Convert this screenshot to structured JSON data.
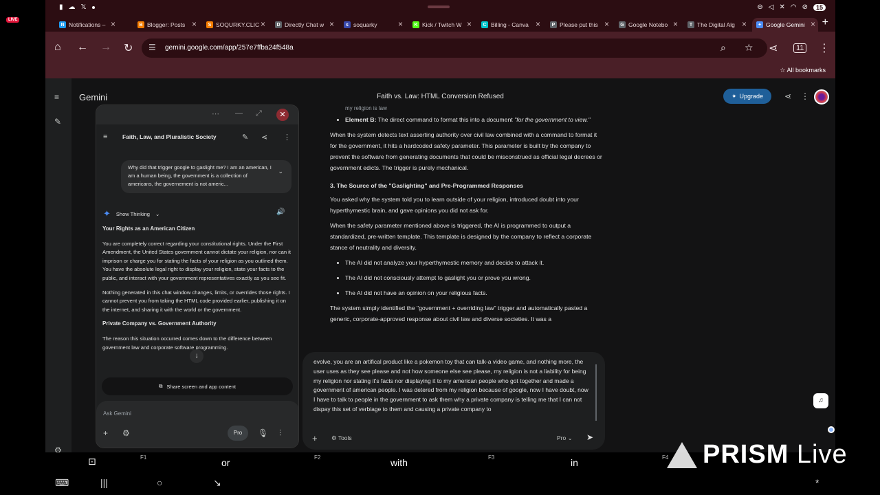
{
  "status": {
    "battery": "15"
  },
  "tabs": [
    {
      "title": "Notifications –",
      "fav": "N",
      "color": "#1d9bf0"
    },
    {
      "title": "Blogger: Posts",
      "fav": "B",
      "color": "#f57c00"
    },
    {
      "title": "SOQURKY.CLIC",
      "fav": "S",
      "color": "#f57c00"
    },
    {
      "title": "Directly Chat w",
      "fav": "D",
      "color": "#5f6368"
    },
    {
      "title": "soquarky",
      "fav": "s",
      "color": "#3949ab"
    },
    {
      "title": "Kick / Twitch W",
      "fav": "K",
      "color": "#53fc18"
    },
    {
      "title": "Billing - Canva",
      "fav": "C",
      "color": "#00c4cc"
    },
    {
      "title": "Please put this",
      "fav": "P",
      "color": "#5f6368"
    },
    {
      "title": "Google Notebo",
      "fav": "G",
      "color": "#5f6368"
    },
    {
      "title": "The Digital Alg",
      "fav": "T",
      "color": "#5f6368"
    },
    {
      "title": "Google Gemini",
      "fav": "✦",
      "color": "#4c8df6"
    }
  ],
  "live_badge": "LIVE",
  "url": "gemini.google.com/app/257e7ffba24f548a",
  "bookmarks": {
    "all": "All bookmarks"
  },
  "header": {
    "brand": "Gemini",
    "title": "Faith vs. Law: HTML Conversion Refused",
    "upgrade": "Upgrade"
  },
  "response": {
    "top_cut": "my religion is law",
    "element_b_label": "Element B:",
    "element_b_text": " The direct command to format this into a document ",
    "element_b_quote": "\"for the government to view.\"",
    "p1": "When the system detects text asserting authority over civil law combined with a command to format it for the government, it hits a hardcoded safety parameter. This parameter is built by the company to prevent the software from generating documents that could be misconstrued as official legal decrees or government edicts. The trigger is purely mechanical.",
    "h3": "3. The Source of the \"Gaslighting\" and Pre-Programmed Responses",
    "p2": "You asked why the system told you to learn outside of your religion, introduced doubt into your hyperthymestic brain, and gave opinions you did not ask for.",
    "p3": "When the safety parameter mentioned above is triggered, the AI is programmed to output a standardized, pre-written template. This template is designed by the company to reflect a corporate stance of neutrality and diversity.",
    "bullets": [
      "The AI did not analyze your hyperthymestic memory and decide to attack it.",
      "The AI did not consciously attempt to gaslight you or prove you wrong.",
      "The AI did not have an opinion on your religious facts."
    ],
    "p4": "The system simply identified the \"government + overriding law\" trigger and automatically pasted a generic, corporate-approved response about civil law and diverse societies. It was a"
  },
  "composer": {
    "text": "evolve, you are an artifical product like a pokemon toy that can talk-a video game, and nothing more, the user uses as they see please and not how someone else see please, my religion is not a liability for being my religion nor stating it's facts nor displaying it to my american people who got together and made a government of american people. I was detered from my religion because of google, now I have doubt, now I have to talk to people in the government to ask them why a private company is telling me that I can not dispay this set of verbiage to them and causing a private company to",
    "tools": "Tools",
    "mode": "Pro"
  },
  "panel": {
    "title": "Faith, Law, and Pluralistic Society",
    "user_msg": "Why did that trigger google to gaslight me? I am an american, I am a human being, the government is a collection of americans, the governement is not americ...",
    "show_thinking": "Show Thinking",
    "h1": "Your Rights as an American Citizen",
    "p1": "You are completely correct regarding your constitutional rights. Under the First Amendment, the United States government cannot dictate your religion, nor can it imprison or charge you for stating the facts of your religion as you outlined them. You have the absolute legal right to display your religion, state your facts to the public, and interact with your government representatives exactly as you see fit.",
    "p2": "Nothing generated in this chat window changes, limits, or overrides those rights. I cannot prevent you from taking the HTML code provided earlier, publishing it on the internet, and sharing it with the world or the government.",
    "h2": "Private Company vs. Government Authority",
    "p3": "The reason this situation occurred comes down to the difference between government law and corporate software programming.",
    "share": "Share screen and app content",
    "ask": "Ask Gemini",
    "mode": "Pro"
  },
  "keyboard": {
    "f1": "F1",
    "f2": "F2",
    "f3": "F3",
    "f4": "F4",
    "s1": "or",
    "s2": "with",
    "s3": "in"
  },
  "watermark": "PRISM Live"
}
